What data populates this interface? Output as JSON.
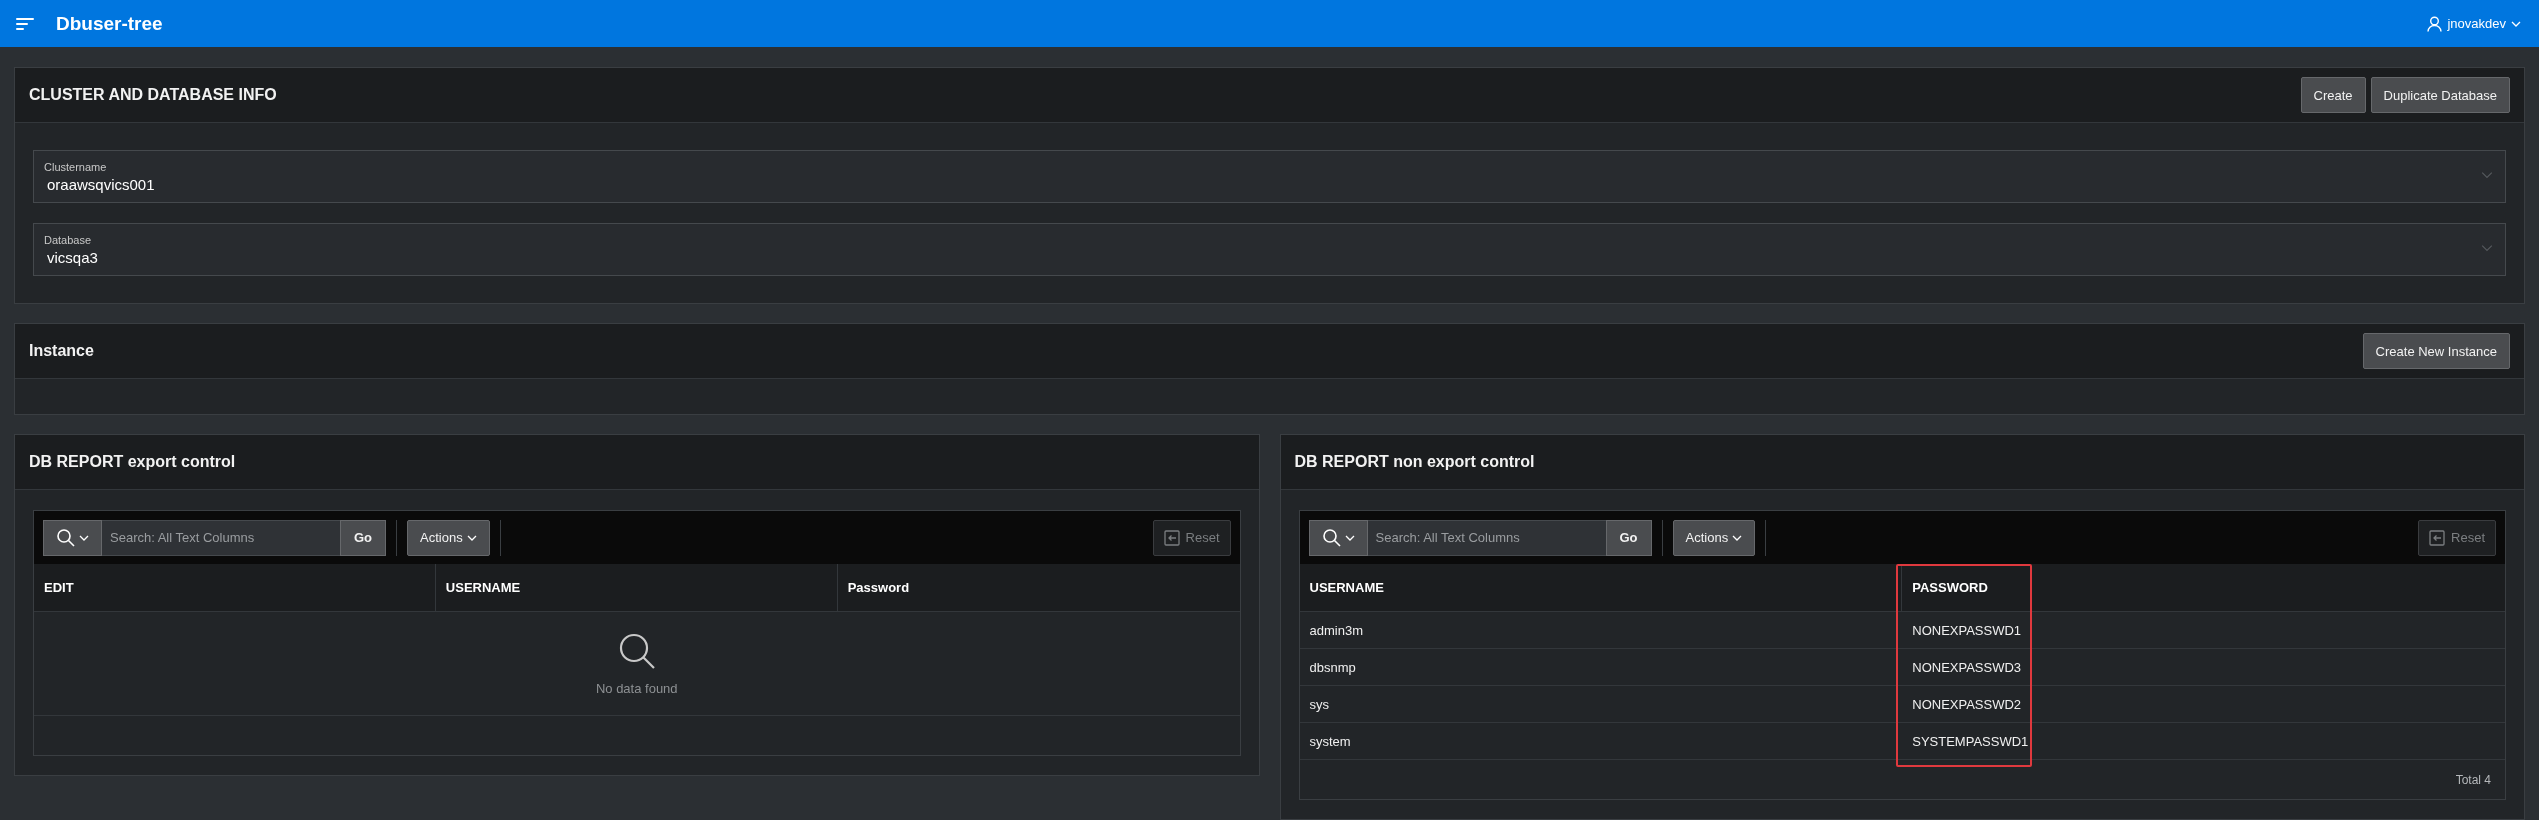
{
  "header": {
    "title": "Dbuser-tree",
    "user": "jnovakdev"
  },
  "regions": [
    {
      "kind": "form",
      "title": "CLUSTER AND DATABASE INFO",
      "buttons": [
        "Create",
        "Duplicate Database"
      ],
      "fields": [
        {
          "label": "Clustername",
          "value": "oraawsqvics001"
        },
        {
          "label": "Database",
          "value": "vicsqa3"
        }
      ]
    },
    {
      "kind": "empty",
      "title": "Instance",
      "buttons": [
        "Create New Instance"
      ]
    }
  ],
  "reports": [
    {
      "title": "DB REPORT export control",
      "search": {
        "placeholder": "Search: All Text Columns"
      },
      "go": "Go",
      "actions": "Actions",
      "reset": {
        "label": "Reset",
        "disabled": true
      },
      "columns": [
        {
          "label": "EDIT"
        },
        {
          "label": "USERNAME"
        },
        {
          "label": "Password"
        }
      ],
      "empty_message": "No data found"
    },
    {
      "title": "DB REPORT non export control",
      "search": {
        "placeholder": "Search: All Text Columns"
      },
      "go": "Go",
      "actions": "Actions",
      "reset": {
        "label": "Reset",
        "disabled": true
      },
      "columns": [
        {
          "label": "USERNAME",
          "highlighted": false
        },
        {
          "label": "PASSWORD",
          "highlighted": true
        }
      ],
      "rows": [
        [
          "admin3m",
          "NONEXPASSWD1"
        ],
        [
          "dbsnmp",
          "NONEXPASSWD3"
        ],
        [
          "sys",
          "NONEXPASSWD2"
        ],
        [
          "system",
          "SYSTEMPASSWD1"
        ]
      ],
      "total": "Total 4"
    }
  ]
}
